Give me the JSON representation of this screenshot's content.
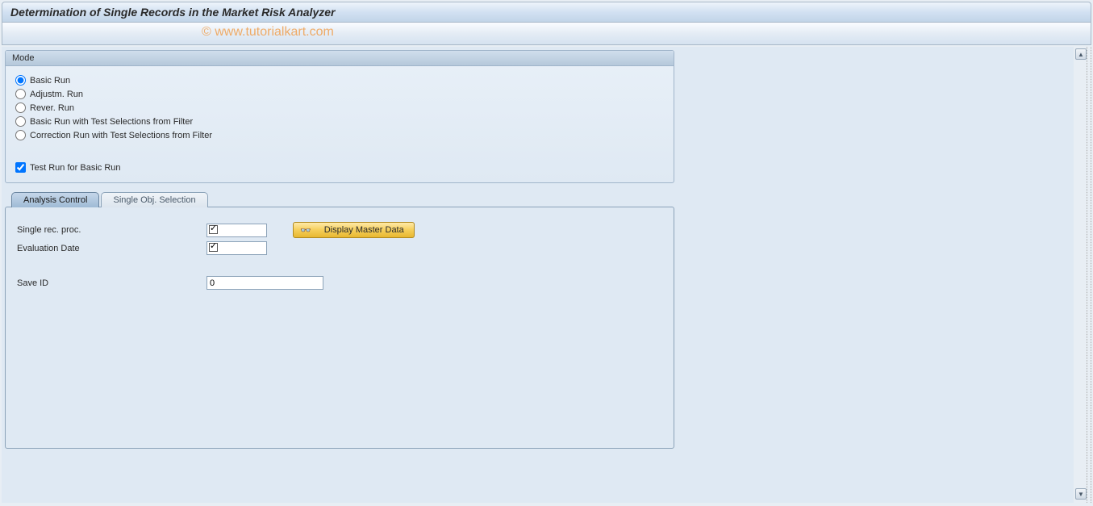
{
  "title": "Determination of Single Records in the Market Risk Analyzer",
  "watermark": "© www.tutorialkart.com",
  "mode_group": {
    "header": "Mode",
    "options": [
      {
        "label": "Basic Run",
        "selected": true
      },
      {
        "label": "Adjustm. Run",
        "selected": false
      },
      {
        "label": "Rever. Run",
        "selected": false
      },
      {
        "label": "Basic Run with Test Selections from Filter",
        "selected": false
      },
      {
        "label": "Correction Run with Test Selections from Filter",
        "selected": false
      }
    ],
    "test_run": {
      "label": "Test Run for Basic Run",
      "checked": true
    }
  },
  "tabs": [
    {
      "label": "Analysis Control",
      "active": true
    },
    {
      "label": "Single Obj. Selection",
      "active": false
    }
  ],
  "analysis_control": {
    "single_rec_proc": {
      "label": "Single rec. proc.",
      "value": ""
    },
    "evaluation_date": {
      "label": "Evaluation Date",
      "value": ""
    },
    "save_id": {
      "label": "Save ID",
      "value": "0"
    },
    "display_master_data_btn": "Display Master Data"
  }
}
